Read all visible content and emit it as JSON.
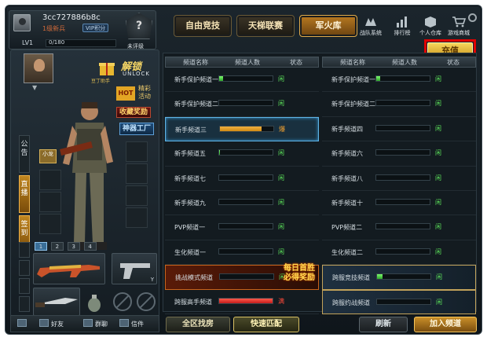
{
  "profile": {
    "username": "3cc727886b8c",
    "rank_text": "1级新兵",
    "vip_label": "VIP积分",
    "level": "LV1",
    "exp": "0/180",
    "rank_status": "未评级"
  },
  "top_tabs": [
    {
      "label": "自由竞技",
      "active": false
    },
    {
      "label": "天梯联赛",
      "active": false
    },
    {
      "label": "军火库",
      "active": true
    }
  ],
  "top_icons": [
    {
      "label": "战队系统",
      "icon": "team-icon"
    },
    {
      "label": "排行榜",
      "icon": "bar-chart-icon"
    },
    {
      "label": "个人仓库",
      "icon": "box-icon"
    },
    {
      "label": "游戏商城",
      "icon": "cart-icon"
    }
  ],
  "recharge_label": "充值",
  "promos": {
    "unlock_title": "解锁",
    "unlock_sub": "UNLOCK",
    "gift_label": "豆丁助手",
    "hot_badge": "HOT",
    "hot_label_1": "精彩",
    "hot_label_2": "活动",
    "collect_label": "收藏奖励",
    "workshop_label": "神器工厂",
    "small_item": "小龙"
  },
  "side_tabs": [
    {
      "label": "公告",
      "active": false
    },
    {
      "label": "直播",
      "active": true
    },
    {
      "label": "签到",
      "active": true
    }
  ],
  "weapon_tabs": [
    "1",
    "2",
    "3",
    "4"
  ],
  "pistol_key": "Y",
  "bottom_left": {
    "friends": "好友",
    "group": "群聊",
    "mail": "信件"
  },
  "channel_headers": {
    "name": "频道名称",
    "count": "频道人数",
    "status": "状态"
  },
  "channels_left": [
    {
      "name": "新手保护频道一",
      "fill": 0.08,
      "status": "闲"
    },
    {
      "name": "新手保护频道二",
      "fill": 0.0,
      "status": "闲"
    },
    {
      "name": "新手频道三",
      "fill": 0.78,
      "status": "爆"
    },
    {
      "name": "新手频道五",
      "fill": 0.02,
      "status": "闲"
    },
    {
      "name": "新手频道七",
      "fill": 0.0,
      "status": "闲"
    },
    {
      "name": "新手频道九",
      "fill": 0.0,
      "status": "闲"
    },
    {
      "name": "PVP频道一",
      "fill": 0.0,
      "status": "闲"
    },
    {
      "name": "生化频道一",
      "fill": 0.0,
      "status": "闲"
    },
    {
      "name": "挑战模式频道",
      "fill": 0.0,
      "status": "闲"
    },
    {
      "name": "跨服高手频道",
      "fill": 1.0,
      "status": "满"
    }
  ],
  "channels_right": [
    {
      "name": "新手保护频道一",
      "fill": 0.08,
      "status": "闲"
    },
    {
      "name": "新手保护频道二",
      "fill": 0.0,
      "status": "闲"
    },
    {
      "name": "新手频道四",
      "fill": 0.0,
      "status": "闲"
    },
    {
      "name": "新手频道六",
      "fill": 0.0,
      "status": "闲"
    },
    {
      "name": "新手频道八",
      "fill": 0.0,
      "status": "闲"
    },
    {
      "name": "新手频道十",
      "fill": 0.0,
      "status": "闲"
    },
    {
      "name": "PVP频道二",
      "fill": 0.0,
      "status": "闲"
    },
    {
      "name": "生化频道二",
      "fill": 0.0,
      "status": "闲"
    },
    {
      "name": "跨服竞技频道",
      "fill": 0.1,
      "status": "闲"
    },
    {
      "name": "跨服约战频道",
      "fill": 0.0,
      "status": "闲"
    }
  ],
  "event_banner": [
    "每日首胜",
    "必得奖励"
  ],
  "bottom_buttons": {
    "all_find": "全区找房",
    "quick_match": "快速匹配",
    "refresh": "刷新",
    "join": "加入频道"
  },
  "colors": {
    "bar_green": "#2fa52a",
    "bar_orange": "#d08a14",
    "bar_red": "#c21c1c",
    "status_green": "#5be05a",
    "status_orange": "#f0a030",
    "status_red": "#ff4a3a",
    "highlight_red": "#e00000"
  }
}
